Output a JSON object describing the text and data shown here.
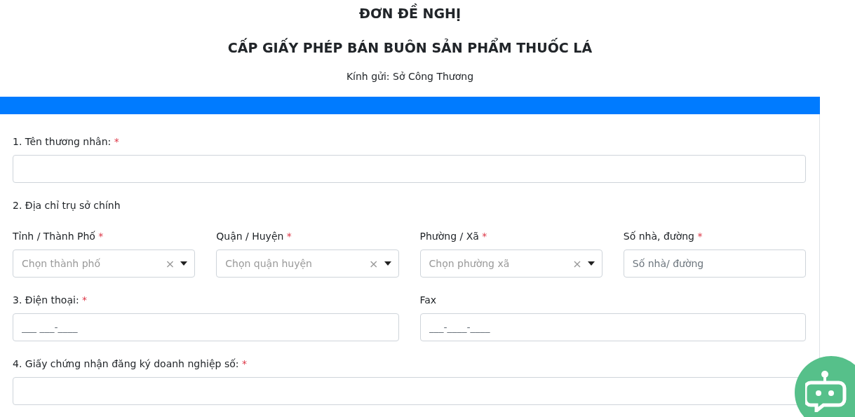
{
  "heading": {
    "title": "ĐƠN ĐỀ NGHỊ",
    "subtitle": "CẤP GIẤY PHÉP BÁN BUÔN SẢN PHẨM THUỐC LÁ",
    "recipient": "Kính gửi: Sở Công Thương"
  },
  "rows": [
    {
      "fields": [
        {
          "kind": "text",
          "label": "1. Tên thương nhân:",
          "mark": "*"
        }
      ]
    },
    {
      "fields": [
        {
          "kind": "heading",
          "label": "2. Địa chỉ trụ sở chính"
        }
      ]
    },
    {
      "fields": [
        {
          "kind": "select",
          "label": "Tỉnh / Thành Phố",
          "mark": "*",
          "placeholder": "Chọn thành phố",
          "clear": "×"
        },
        {
          "kind": "select",
          "label": "Quận / Huyện",
          "mark": "*",
          "placeholder": "Chọn quận huyện",
          "clear": "×"
        },
        {
          "kind": "select",
          "label": "Phường / Xã",
          "mark": "*",
          "placeholder": "Chọn phường xã",
          "clear": "×"
        },
        {
          "kind": "text",
          "label": "Số nhà, đường",
          "mark": "*",
          "placeholder": "Số nhà/ đường"
        }
      ]
    },
    {
      "fields": [
        {
          "kind": "text",
          "label": "3. Điện thoại:",
          "mark": "*",
          "placeholder": "___ ___-____"
        },
        {
          "kind": "text",
          "label": "Fax",
          "placeholder": "___-____-____"
        }
      ]
    },
    {
      "fields": [
        {
          "kind": "text",
          "label": "4. Giấy chứng nhận đăng ký doanh nghiệp số:",
          "mark": "*"
        }
      ]
    }
  ]
}
